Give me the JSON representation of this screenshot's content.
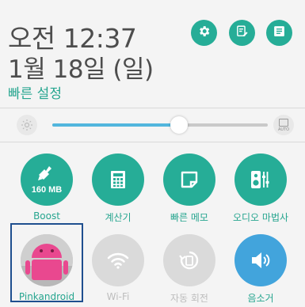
{
  "header": {
    "time": "오전 12:37",
    "date": "1월 18일 (일)",
    "quick_settings_link": "빠른 설정",
    "icons": [
      "gear-icon",
      "edit-icon",
      "notes-icon"
    ]
  },
  "brightness": {
    "level_percent": 59,
    "auto_label": "AUTO"
  },
  "tiles": [
    {
      "label": "Boost",
      "sub": "160 MB",
      "icon": "broom-icon",
      "active": true
    },
    {
      "label": "계산기",
      "icon": "calculator-icon",
      "active": true
    },
    {
      "label": "빠른 메모",
      "icon": "memo-icon",
      "active": true
    },
    {
      "label": "오디오 마법사",
      "icon": "speaker-eq-icon",
      "active": true
    },
    {
      "label": "Pinkandroid",
      "icon": "android-avatar",
      "active": true
    },
    {
      "label": "Wi-Fi",
      "icon": "wifi-icon",
      "active": false
    },
    {
      "label": "자동 회전",
      "icon": "rotate-icon",
      "active": false
    },
    {
      "label": "음소거",
      "icon": "volume-icon",
      "active": true
    }
  ],
  "colors": {
    "accent": "#26ad97",
    "blue_tile": "#42a4dc",
    "inactive": "#d9d9d9",
    "slider": "#52b6dd"
  }
}
